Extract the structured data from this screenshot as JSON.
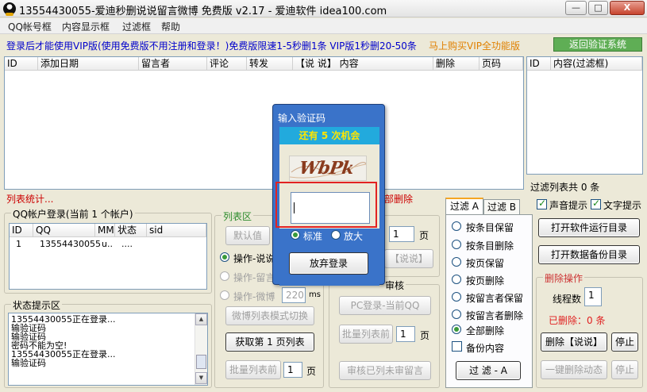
{
  "window": {
    "title": "13554430055-爱迪秒删说说留言微博 免费版 v2.17 - 爱迪软件 idea100.com",
    "min_glyph": "—",
    "max_glyph": "□",
    "close_glyph": "X"
  },
  "menu": {
    "items": [
      "QQ帐号框",
      "内容显示框",
      "过滤框",
      "帮助"
    ]
  },
  "notice": {
    "text": "登录后才能使用VIP版(使用免费版不用注册和登录！)免费版限速1-5秒删1条 VIP版1秒删20-50条",
    "buy": "马上购买VIP全功能版",
    "back_button": "返回验证系统"
  },
  "main_list": {
    "columns": [
      "ID",
      "添加日期",
      "留言者",
      "评论",
      "转发",
      "【说 说】 内容",
      "删除",
      "页码"
    ]
  },
  "filter_list": {
    "columns": [
      "ID",
      "内容(过滤框)"
    ],
    "total": "过滤列表共 0 条"
  },
  "list_stats": "列表统计...",
  "delete_all_fragment": "部删除",
  "accounts": {
    "title": "QQ帐户登录(当前 1 个帐户)",
    "columns": [
      "ID",
      "QQ",
      "MM",
      "状态",
      "sid"
    ],
    "rows": [
      {
        "id": "1",
        "qq": "13554430055",
        "mm": "u..",
        "status": "....",
        "sid": ""
      }
    ]
  },
  "status_box": {
    "title": "状态提示区",
    "lines": [
      "13554430055正在登录...",
      "输验证码",
      "输验证码",
      "密码不能为空!",
      "13554430055正在登录...",
      "输验证码"
    ]
  },
  "list_area": {
    "title": "列表区",
    "default_button": "默认值",
    "option_shuoshuo": "操作-说说",
    "option_liuyan": "操作-留言",
    "option_weibo": "操作-微博",
    "weibo_value": "220",
    "weibo_unit": "ms",
    "weibo_mode_button": "微博列表模式切换",
    "fetch_button": "获取第 1 页列表",
    "batch_button": "批量列表前",
    "batch_value": "1",
    "page_unit": "页"
  },
  "middle_panel": {
    "page_value": "1",
    "page_unit": "页",
    "shuoshuo_button": "【说说】",
    "audit_title": "审核",
    "pc_login_button": "PC登录-当前QQ",
    "batch_button": "批量列表前",
    "batch_value": "1",
    "page_unit2": "页",
    "audit_button": "审核已列未审留言"
  },
  "filter_tabs": {
    "tab_a": "过滤 A",
    "tab_b": "过滤 B",
    "options": [
      "按条目保留",
      "按条目删除",
      "按页保留",
      "按页删除",
      "按留言者保留",
      "按留言者删除",
      "全部删除"
    ],
    "backup_label": "备份内容",
    "filter_button": "过 滤 - A"
  },
  "right_panel": {
    "sound_label": "声音提示",
    "text_label": "文字提示",
    "open_log_button": "打开软件运行目录",
    "open_backup_button": "打开数据备份目录",
    "delete_ops_title": "删除操作",
    "threads_label": "线程数",
    "threads_value": "1",
    "deleted_label": "已删除：0 条",
    "delete_button": "删除【说说】",
    "stop_button": "停止",
    "one_click_button": "一键删除动态",
    "stop2_button": "停止"
  },
  "captcha_dialog": {
    "title": "输入验证码",
    "chances": "还有 5 次机会",
    "captcha_text": "WbPk",
    "input_value": "",
    "mode_standard": "标准",
    "mode_zoom": "放大",
    "give_up_button": "放弃登录"
  },
  "colors": {
    "notice_blue": "#0000cc",
    "buy_orange": "#e08000",
    "back_green": "#5fae55",
    "stat_red": "#cc0000",
    "dialog_blue": "#3a73c9",
    "chances_bg": "#22aadd",
    "chances_text": "#ffe600",
    "highlight_red": "#e22222"
  }
}
